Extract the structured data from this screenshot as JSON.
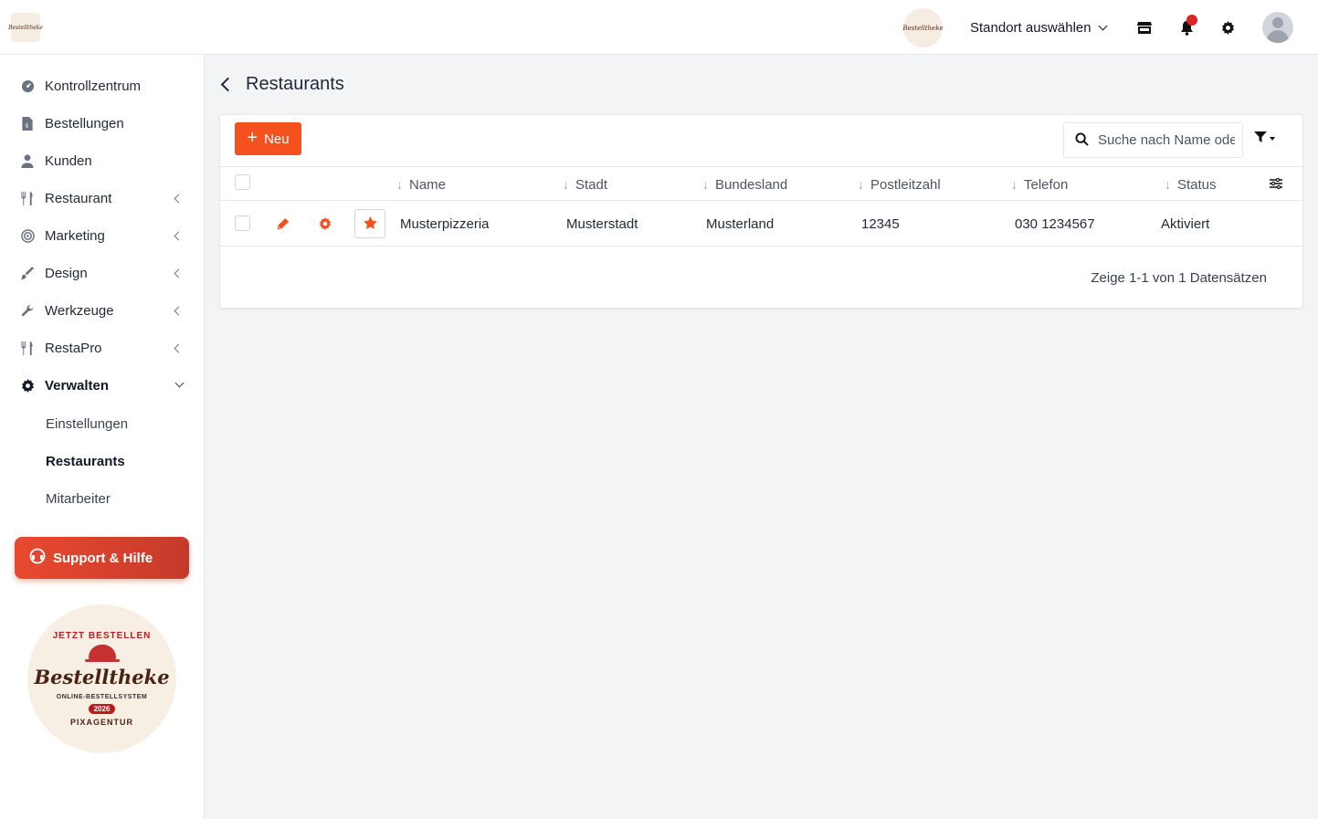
{
  "topbar": {
    "brand_mini_text": "Bestelltheke",
    "location_logo_text": "Bestelltheke",
    "location_select_label": "Standort auswählen",
    "icons": [
      "store-icon",
      "bell-icon",
      "gear-icon",
      "avatar-icon"
    ],
    "notification_color": "#dc2626"
  },
  "sidebar": {
    "items": [
      {
        "label": "Kontrollzentrum",
        "icon": "dashboard-icon"
      },
      {
        "label": "Bestellungen",
        "icon": "receipt-icon"
      },
      {
        "label": "Kunden",
        "icon": "user-icon"
      },
      {
        "label": "Restaurant",
        "icon": "utensils-icon"
      },
      {
        "label": "Marketing",
        "icon": "target-icon"
      },
      {
        "label": "Design",
        "icon": "brush-icon"
      },
      {
        "label": "Werkzeuge",
        "icon": "wrench-icon"
      },
      {
        "label": "RestaPro",
        "icon": "utensils-icon"
      },
      {
        "label": "Verwalten",
        "icon": "gear-icon"
      }
    ],
    "sub_items": [
      {
        "label": "Einstellungen"
      },
      {
        "label": "Restaurants"
      },
      {
        "label": "Mitarbeiter"
      }
    ],
    "support_label": "Support & Hilfe",
    "badge": {
      "arc_top": "JETZT BESTELLEN",
      "wordmark": "Bestelltheke",
      "subline": "ONLINE-BESTELLSYSTEM",
      "year": "2026",
      "arc_bottom": "PIXAGENTUR"
    }
  },
  "main": {
    "title": "Restaurants",
    "new_button_label": "Neu",
    "search_placeholder": "Suche nach Name oder",
    "columns": [
      "Name",
      "Stadt",
      "Bundesland",
      "Postleitzahl",
      "Telefon",
      "Status"
    ],
    "rows": [
      {
        "name": "Musterpizzeria",
        "city": "Musterstadt",
        "state": "Musterland",
        "zip": "12345",
        "phone": "030 1234567",
        "status": "Aktiviert"
      }
    ],
    "footer": "Zeige 1-1 von 1 Datensätzen",
    "accent_color": "#f4511e"
  }
}
